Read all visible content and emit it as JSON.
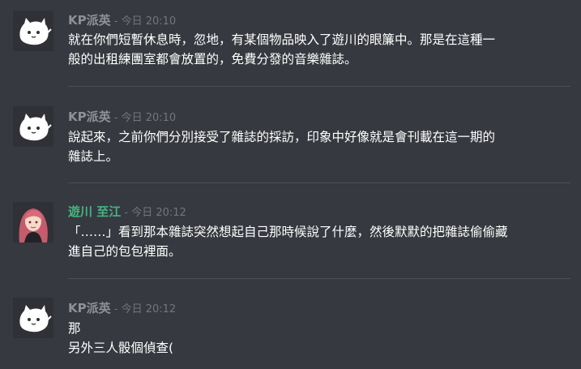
{
  "messages": [
    {
      "author": "KP派英",
      "sep": " - ",
      "timestamp": "今日 20:10",
      "lines": [
        "就在你們短暫休息時，忽地，有某個物品映入了遊川的眼簾中。那是在這種一",
        "般的出租練團室都會放置的，免費分發的音樂雜誌。"
      ]
    },
    {
      "author": "KP派英",
      "sep": " - ",
      "timestamp": "今日 20:10",
      "lines": [
        "說起來，之前你們分別接受了雜誌的採訪，印象中好像就是會刊載在這一期的",
        "雜誌上。"
      ]
    },
    {
      "author": "遊川 至江",
      "sep": " - ",
      "timestamp": "今日 20:12",
      "lines": [
        "「……」看到那本雜誌突然想起自己那時候說了什麼，然後默默的把雜誌偷偷藏",
        "進自己的包包裡面。"
      ]
    },
    {
      "author": "KP派英",
      "sep": " - ",
      "timestamp": "今日 20:12",
      "lines": [
        "那",
        "另外三人骰個偵查("
      ]
    }
  ],
  "colors": {
    "background": "#36393f",
    "kp_name": "#8e9297",
    "player_name": "#43b581",
    "timestamp": "#72767d",
    "text": "#ffffff"
  },
  "icons": {
    "kp_avatar": "white-cat-icon",
    "player_avatar": "pink-hair-girl-avatar"
  }
}
